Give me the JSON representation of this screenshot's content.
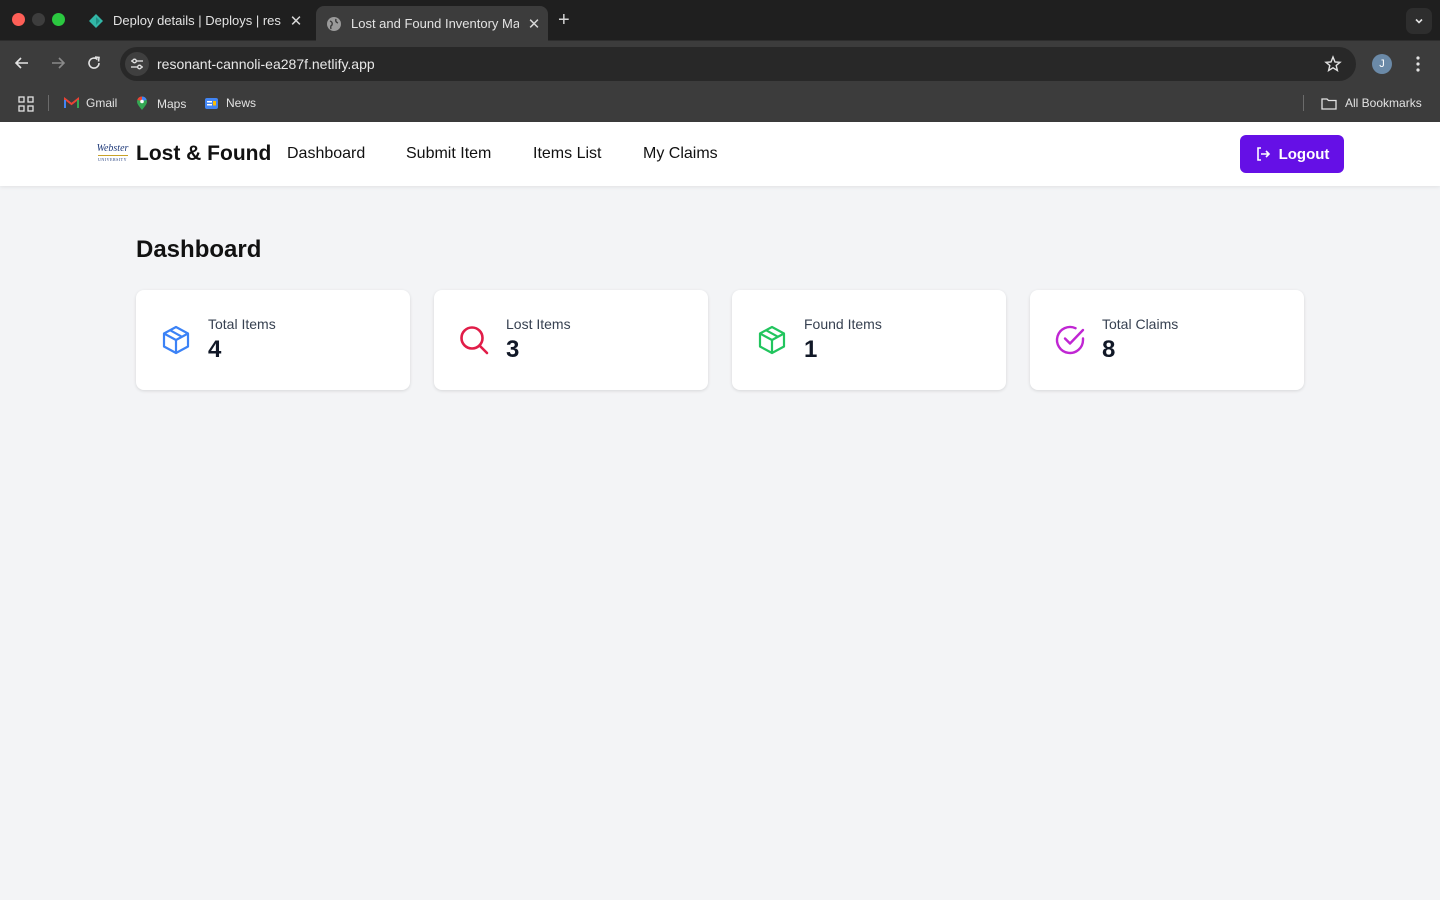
{
  "browser": {
    "tabs": [
      {
        "title": "Deploy details | Deploys | reso",
        "icon": "netlify-icon"
      },
      {
        "title": "Lost and Found Inventory Man",
        "icon": "globe-icon",
        "active": true
      }
    ],
    "url": "resonant-cannoli-ea287f.netlify.app",
    "profile_initial": "J",
    "bookmarks": [
      {
        "label": "Gmail",
        "icon": "gmail-icon"
      },
      {
        "label": "Maps",
        "icon": "maps-icon"
      },
      {
        "label": "News",
        "icon": "news-icon"
      }
    ],
    "all_bookmarks": "All Bookmarks"
  },
  "header": {
    "logo_text": "Webster",
    "logo_subtext": "UNIVERSITY",
    "brand": "Lost & Found",
    "nav": [
      "Dashboard",
      "Submit Item",
      "Items List",
      "My Claims"
    ],
    "logout_label": "Logout",
    "accent_color": "#6510e6"
  },
  "main": {
    "title": "Dashboard",
    "stats": [
      {
        "label": "Total Items",
        "value": "4",
        "icon": "box-icon",
        "color": "#3b82f6"
      },
      {
        "label": "Lost Items",
        "value": "3",
        "icon": "search-icon",
        "color": "#e11d48"
      },
      {
        "label": "Found Items",
        "value": "1",
        "icon": "box-icon",
        "color": "#22c55e"
      },
      {
        "label": "Total Claims",
        "value": "8",
        "icon": "check-circle-icon",
        "color": "#c026d3"
      }
    ]
  }
}
